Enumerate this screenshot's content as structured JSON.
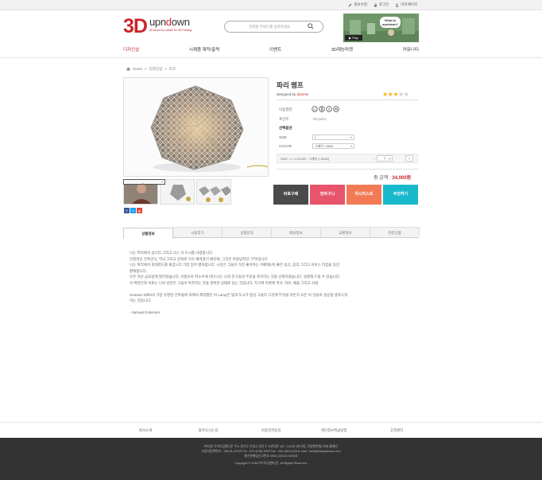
{
  "toplinks": [
    "정보수정",
    "로그인",
    "마이페이지"
  ],
  "logo": {
    "main": "3D",
    "brand_a": "upn",
    "brand_b": "d",
    "brand_c": "own",
    "tagline": "All about for mobile for 3D Printing"
  },
  "search": {
    "placeholder": "검색할 키워드를 입력하세요"
  },
  "banner": {
    "bubble": "What is upndown?",
    "play": "▶ Play"
  },
  "nav": [
    "디자인샵",
    "시제품 제작/출력",
    "이벤트",
    "3D재능마켓",
    "커뮤니티"
  ],
  "breadcrumb": [
    "Home",
    ">",
    "디자인샵",
    ">",
    "토츠"
  ],
  "product": {
    "title": "파리 램프",
    "designer_prefix": "designed by",
    "designer": "dolorse",
    "rating": 3,
    "license_label": "이용권한",
    "points_label": "포인트",
    "points_value": "50 point",
    "options_title": "선택옵션",
    "size_label": "SIZE",
    "size_value": "L",
    "color_label": "COLOR",
    "color_value": "그레이 +3000",
    "summary": "SIZE : L / COLOR : 그레이 (+3000)",
    "qty": "1",
    "total_label": "총 금액 :",
    "total_value": "34,000원"
  },
  "buttons": {
    "buy": "바로구매",
    "cart": "장바구니",
    "wish": "위시리스트",
    "recommend": "추천하기"
  },
  "colors": {
    "buy": "#4a4a4a",
    "cart": "#e7546b",
    "wish": "#f27b55",
    "recommend": "#19b9cb",
    "accent": "#c9262b"
  },
  "tabs": [
    "상품정보",
    "사용후기",
    "상품문의",
    "배송정보",
    "교환정보",
    "관련상품"
  ],
  "description": [
    "나는 파리에서 삽니다 그리고 나는 이 도시를 사랑합니다.",
    "안정적인 건축양식, 역사 그리고 문화로 가득 채워졌기 때문에, 그것은 아름답지만, 무엇입니다",
    "나는 파리에서 최대한도를 즐겁니다 가장 있어 별처럼니다. 시민은 그들이 가장 좋아하는 카페에(서) 좋은 음식, 음악 그리고 서비스 타임을 등안",
    "편해합니다.",
    "우웃 지난 금요일에 말아넣습니다, 이름모아 파소수에 의미 나는 나의 친구들과 주운을 축하하는 것을 선택하였습니다. 설명해 드릴 수 있습니다.",
    "이 여연인과 서로는 나의 방문은 그들이 마찬하는 것을 경축한 상태로 있는 것입니다. 지구에 미룬에 역사, 자유, 예술 그리고 사랑.",
    "",
    "Gustave Eiffel의 가장 유명한 건조물에 의해서 제작했던 이 Lamp은 빛과 도시가 항상 그들이 그것에 무엇을 하든지 모든 이 것들의 성공형 생각나게",
    "하는 것입니다.",
    "",
    "- Samuel N.Bernier"
  ],
  "footer_links": [
    "회사소개",
    "찾아오시는길",
    "이용약관동의",
    "개인정보취급방침",
    "고객센터"
  ],
  "footer_lines": [
    "㈜사랑 이이디업앤다운 주소:경기도 안양시 동안구 시민대로 167, 1111호 (비산동, 안양벤처텔) 대표:홍예선",
    "사업자등록번호 : 138-81-67978 Tel : 070-4138-1999 Fax : 031-383-1016 E-mail : hello@3dupndown.com",
    "통신판매업신고번호 0000-OOOO-0000호",
    "Copyright © 2016 이이디업앤다운. All Rights Reserved."
  ]
}
